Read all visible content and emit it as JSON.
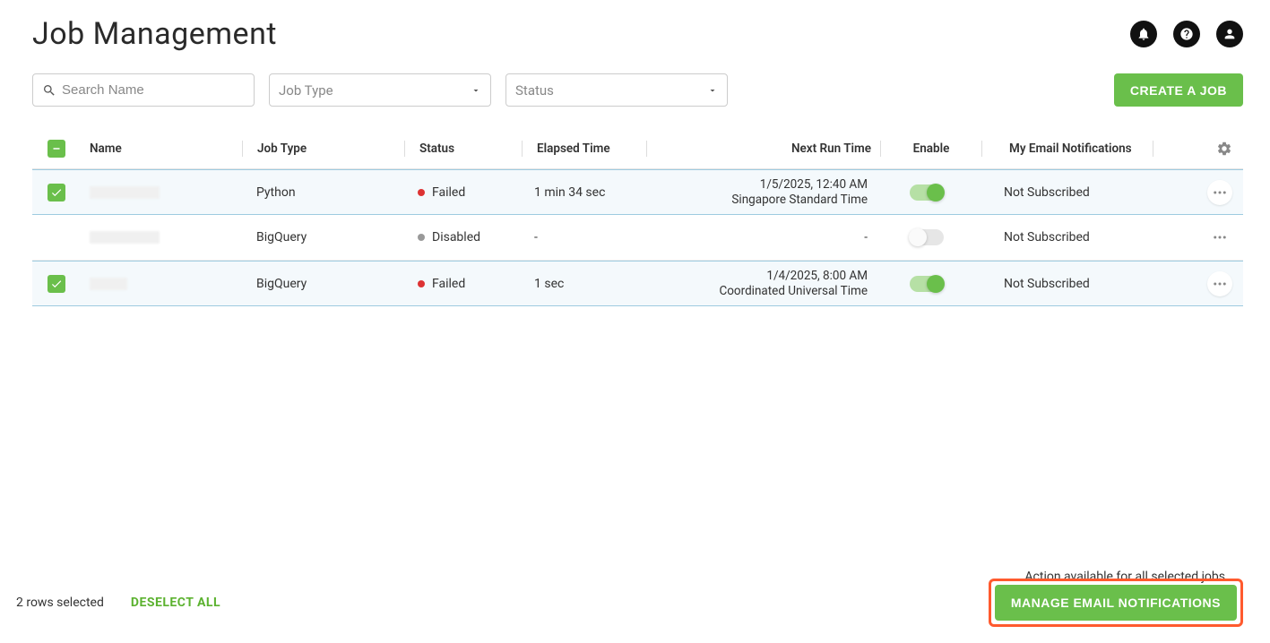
{
  "header": {
    "title": "Job Management"
  },
  "toolbar": {
    "searchPlaceholder": "Search Name",
    "jobTypeLabel": "Job Type",
    "statusLabel": "Status",
    "createLabel": "CREATE A JOB"
  },
  "columns": {
    "name": "Name",
    "jobType": "Job Type",
    "status": "Status",
    "elapsed": "Elapsed Time",
    "nextRun": "Next Run Time",
    "enable": "Enable",
    "emailNotif": "My Email Notifications"
  },
  "rows": [
    {
      "selected": true,
      "jobType": "Python",
      "statusDot": "failed",
      "status": "Failed",
      "elapsed": "1 min 34 sec",
      "nextRunLine1": "1/5/2025, 12:40 AM",
      "nextRunLine2": "Singapore Standard Time",
      "enabled": true,
      "emailNotif": "Not Subscribed"
    },
    {
      "selected": false,
      "jobType": "BigQuery",
      "statusDot": "disabled",
      "status": "Disabled",
      "elapsed": "-",
      "nextRunLine1": "-",
      "nextRunLine2": "",
      "enabled": false,
      "emailNotif": "Not Subscribed"
    },
    {
      "selected": true,
      "jobType": "BigQuery",
      "statusDot": "failed",
      "status": "Failed",
      "elapsed": "1 sec",
      "nextRunLine1": "1/4/2025, 8:00 AM",
      "nextRunLine2": "Coordinated Universal Time",
      "enabled": true,
      "emailNotif": "Not Subscribed"
    }
  ],
  "footer": {
    "note": "Action available for all selected jobs",
    "rowsSelected": "2 rows selected",
    "deselect": "DESELECT ALL",
    "manage": "MANAGE EMAIL NOTIFICATIONS"
  }
}
